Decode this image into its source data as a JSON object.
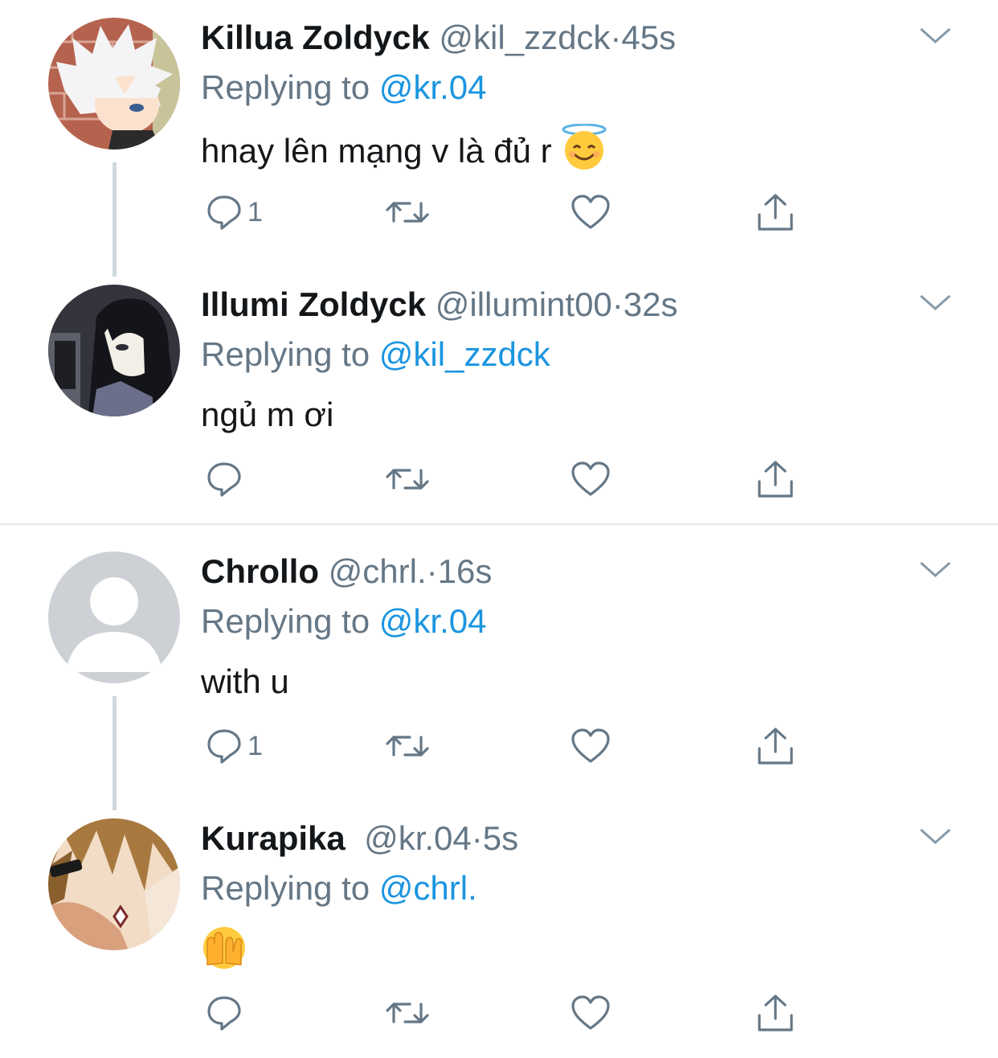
{
  "colors": {
    "name": "#14171a",
    "muted": "#657786",
    "link": "#1b95e0",
    "thread_line": "#cfd9de",
    "divider": "#e1e8ed"
  },
  "tweets": [
    {
      "name": "Killua Zoldyck",
      "handle": "@kil_zzdck",
      "dot": "·",
      "time": "45s",
      "replying_label": "Replying to",
      "replying_to": "@kr.04",
      "text": "hnay lên mạng v là đủ r",
      "emoji": "smiling-face-with-halo",
      "reply_count": "1",
      "avatar": "killua-avatar"
    },
    {
      "name": "Illumi Zoldyck",
      "handle": "@illumint00",
      "dot": "·",
      "time": "32s",
      "replying_label": "Replying to",
      "replying_to": "@kil_zzdck",
      "text": "ngủ m ơi",
      "reply_count": "",
      "avatar": "illumi-avatar"
    },
    {
      "name": "Chrollo",
      "handle": "@chrl.",
      "dot": "·",
      "time": "16s",
      "replying_label": "Replying to",
      "replying_to": "@kr.04",
      "text": "with u",
      "reply_count": "1",
      "avatar": "default-avatar"
    },
    {
      "name": "Kurapika",
      "handle": "@kr.04",
      "dot": "·",
      "time": "5s",
      "replying_label": "Replying to",
      "replying_to": "@chrl.",
      "text": "",
      "emoji": "face-with-peeking-eye",
      "reply_count": "",
      "avatar": "kurapika-avatar"
    }
  ],
  "icons": [
    "reply-icon",
    "retweet-icon",
    "like-icon",
    "share-icon",
    "chevron-down-icon"
  ]
}
